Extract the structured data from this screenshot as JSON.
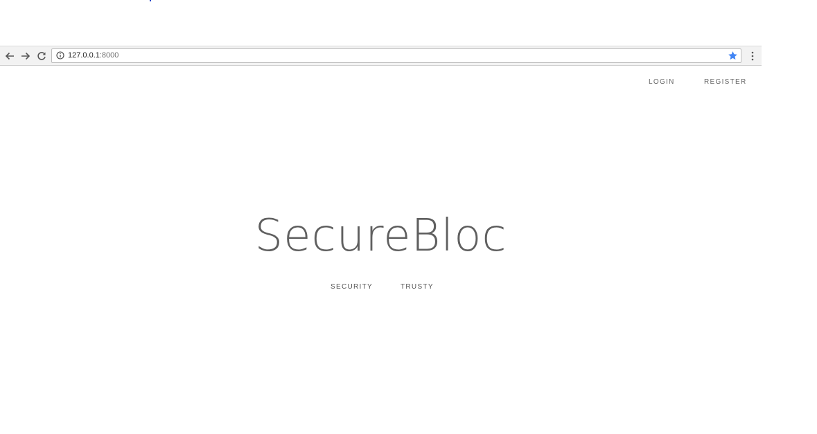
{
  "browser": {
    "url_host": "127.0.0.1",
    "url_port": ":8000",
    "accent_color": "#4285f4"
  },
  "site_nav": {
    "login_label": "LOGIN",
    "register_label": "REGISTER"
  },
  "hero": {
    "brand": "SecureBloc",
    "tags": [
      "SECURITY",
      "TRUSTY"
    ]
  },
  "icons": {
    "back": "arrow-left-icon",
    "forward": "arrow-right-icon",
    "reload": "reload-icon",
    "site_info": "info-icon",
    "bookmark": "star-icon",
    "menu": "more-vertical-icon"
  }
}
